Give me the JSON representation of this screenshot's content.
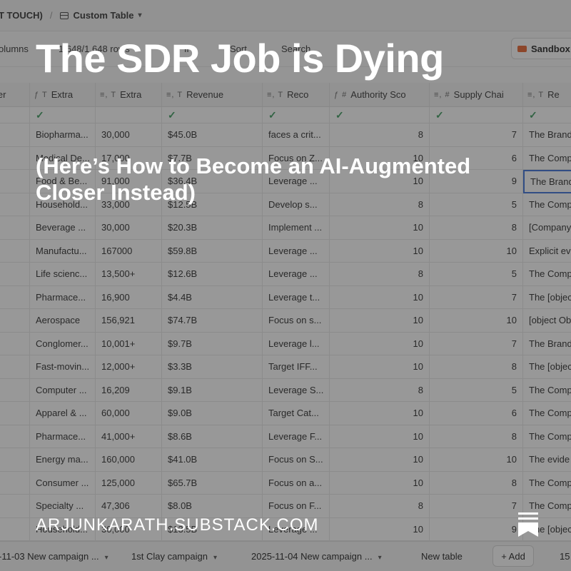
{
  "topbar": {
    "crumb": "T TOUCH)",
    "sep": "/",
    "table_name": "Custom Table",
    "chevron": "▾"
  },
  "toolbar": {
    "columns": "olumns",
    "rows": "1,648/1,648 rows",
    "filter": "fi",
    "sort": "Sort",
    "search": "Search",
    "sandbox": "Sandbox"
  },
  "grid": {
    "columns": [
      {
        "label": "nfer",
        "icon": ""
      },
      {
        "label": "Extra",
        "icon": "ƒ T"
      },
      {
        "label": "Extra",
        "icon": "≡, T"
      },
      {
        "label": "Revenue",
        "icon": "≡, T"
      },
      {
        "label": "Reco",
        "icon": "≡, T"
      },
      {
        "label": "Authority Sco",
        "icon": "ƒ #"
      },
      {
        "label": "Supply Chai",
        "icon": "≡, #"
      },
      {
        "label": "Re",
        "icon": "≡, T"
      }
    ],
    "check_row": [
      "",
      "✓",
      "",
      "✓",
      "✓",
      "✓",
      "✓",
      "✓"
    ],
    "rows": [
      [
        "",
        "Biopharma...",
        "30,000",
        "$45.0B",
        "faces a crit...",
        "8",
        "7",
        "The Brand"
      ],
      [
        "",
        "Medical De...",
        "17,000",
        "$7.7B",
        "Focus on Z...",
        "10",
        "6",
        "The Comp"
      ],
      [
        "",
        "Food & Be...",
        "91,000",
        "$36.4B",
        "Leverage ...",
        "10",
        "9",
        "The Brand"
      ],
      [
        "",
        "Household...",
        "33,000",
        "$12.5B",
        "Develop s...",
        "8",
        "5",
        "The Comp"
      ],
      [
        "",
        "Beverage ...",
        "30,000",
        "$20.3B",
        "Implement ...",
        "10",
        "8",
        "[Company"
      ],
      [
        "",
        "Manufactu...",
        "167000",
        "$59.8B",
        "Leverage ...",
        "10",
        "10",
        "Explicit ev"
      ],
      [
        "",
        "Life scienc...",
        "13,500+",
        "$12.6B",
        "Leverage ...",
        "8",
        "5",
        "The Comp"
      ],
      [
        "",
        "Pharmace...",
        "16,900",
        "$4.4B",
        "Leverage t...",
        "10",
        "7",
        "The [objec"
      ],
      [
        "",
        "Aerospace",
        "156,921",
        "$74.7B",
        "Focus on s...",
        "10",
        "10",
        "[object Ob"
      ],
      [
        "",
        "Conglomer...",
        "10,001+",
        "$9.7B",
        "Leverage l...",
        "10",
        "7",
        "The Brand"
      ],
      [
        "",
        "Fast-movin...",
        "12,000+",
        "$3.3B",
        "Target IFF...",
        "10",
        "8",
        "The [objec"
      ],
      [
        "",
        "Computer ...",
        "16,209",
        "$9.1B",
        "Leverage S...",
        "8",
        "5",
        "The Comp"
      ],
      [
        "",
        "Apparel & ...",
        "60,000",
        "$9.0B",
        "Target Cat...",
        "10",
        "6",
        "The Comp"
      ],
      [
        "",
        "Pharmace...",
        "41,000+",
        "$8.6B",
        "Leverage F...",
        "10",
        "8",
        "The Comp"
      ],
      [
        "",
        "Energy ma...",
        "160,000",
        "$41.0B",
        "Focus on S...",
        "10",
        "10",
        "The evide"
      ],
      [
        "",
        "Consumer ...",
        "125,000",
        "$65.7B",
        "Focus on a...",
        "10",
        "8",
        "The Comp"
      ],
      [
        "",
        "Specialty ...",
        "47,306",
        "$8.0B",
        "Focus on F...",
        "8",
        "7",
        "The Comp"
      ],
      [
        "",
        "Household...",
        "30,000",
        "$13.5B",
        "Leverage ...",
        "10",
        "9",
        "The [objec"
      ]
    ]
  },
  "bottombar": {
    "tab1": "-11-03 New campaign ...",
    "tab2": "1st Clay campaign",
    "tab3": "2025-11-04 New campaign ...",
    "tab4": "New table",
    "add": "+ Add",
    "page_num": "15"
  },
  "overlay": {
    "title": "The SDR Job is Dying",
    "subtitle": "(Here’s How to Become an AI-Augmented Closer Instead)",
    "domain": "ARJUNKARATH.SUBSTACK.COM",
    "icon": "bookmark-icon"
  }
}
